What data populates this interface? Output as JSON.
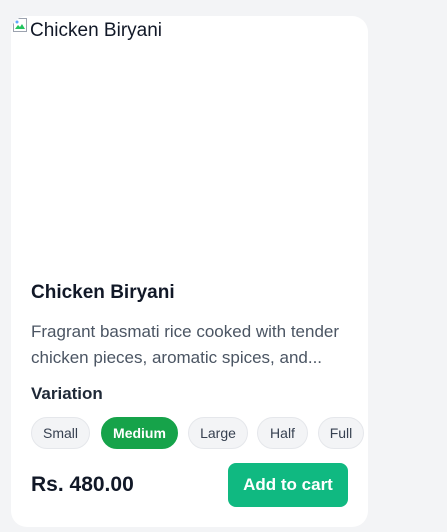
{
  "product": {
    "image_alt": "Chicken Biryani",
    "name": "Chicken Biryani",
    "description": "Fragrant basmati rice cooked with tender chicken pieces, aromatic spices, and..."
  },
  "variation": {
    "label": "Variation",
    "options": [
      "Small",
      "Medium",
      "Large",
      "Half",
      "Full"
    ],
    "selected": "Medium"
  },
  "price": "Rs. 480.00",
  "add_to_cart_label": "Add to cart",
  "colors": {
    "accent": "#10b981",
    "selected_chip": "#16a34a"
  },
  "icons": {
    "image_placeholder": "broken-image-icon"
  }
}
